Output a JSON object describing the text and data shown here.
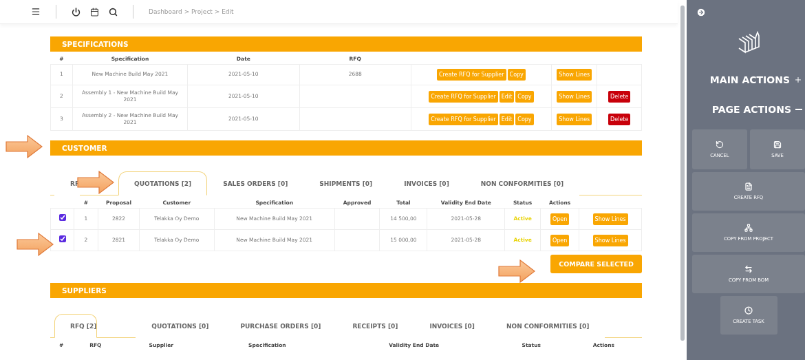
{
  "breadcrumb": "Dashboard > Project > Edit",
  "specifications": {
    "title": "SPECIFICATIONS",
    "columns": [
      "#",
      "Specification",
      "Date",
      "RFQ"
    ],
    "rows": [
      {
        "cells": [
          "1",
          "New Machine Build May 2021",
          "2021-05-10",
          "2688"
        ],
        "actions": [
          "Create RFQ for Supplier",
          "Copy"
        ],
        "show_lines": "Show Lines"
      },
      {
        "cells": [
          "2",
          "Assembly 1 - New Machine Build May 2021",
          "2021-05-10",
          ""
        ],
        "actions": [
          "Create RFQ for Supplier",
          "Edit",
          "Copy"
        ],
        "show_lines": "Show Lines",
        "delete": "Delete"
      },
      {
        "cells": [
          "3",
          "Assembly 2 - New Machine Build May 2021",
          "2021-05-10",
          ""
        ],
        "actions": [
          "Create RFQ for Supplier",
          "Edit",
          "Copy"
        ],
        "show_lines": "Show Lines",
        "delete": "Delete"
      }
    ]
  },
  "customer": {
    "title": "CUSTOMER",
    "tabs": [
      {
        "label": "RF",
        "selected": false
      },
      {
        "label": "QUOTATIONS [2]",
        "selected": true
      },
      {
        "label": "SALES ORDERS [0]",
        "selected": false
      },
      {
        "label": "SHIPMENTS [0]",
        "selected": false
      },
      {
        "label": "INVOICES [0]",
        "selected": false
      },
      {
        "label": "NON CONFORMITIES [0]",
        "selected": false
      }
    ],
    "columns": [
      "#",
      "Proposal",
      "Customer",
      "Specification",
      "Approved",
      "Total",
      "Validity End Date",
      "Status",
      "Actions"
    ],
    "rows": [
      {
        "checked": true,
        "cells": [
          "1",
          "2822",
          "Telakka Oy Demo",
          "New Machine Build May 2021",
          "",
          "14 500,00",
          "2021-05-28"
        ],
        "status": "Active",
        "actions": [
          "Open",
          "Show Lines"
        ]
      },
      {
        "checked": true,
        "cells": [
          "2",
          "2821",
          "Telakka Oy Demo",
          "New Machine Build May 2021",
          "",
          "15 000,00",
          "2021-05-28"
        ],
        "status": "Active",
        "actions": [
          "Open",
          "Show Lines"
        ]
      }
    ],
    "compare_button": "COMPARE SELECTED"
  },
  "suppliers": {
    "title": "SUPPLIERS",
    "tabs": [
      {
        "label": "RFQ [2]",
        "selected": true
      },
      {
        "label": "QUOTATIONS [0]",
        "selected": false
      },
      {
        "label": "PURCHASE ORDERS [0]",
        "selected": false
      },
      {
        "label": "RECEIPTS [0]",
        "selected": false
      },
      {
        "label": "INVOICES [0]",
        "selected": false
      },
      {
        "label": "NON CONFORMITIES [0]",
        "selected": false
      }
    ],
    "columns": [
      "#",
      "RFQ",
      "Supplier",
      "Specification",
      "Validity End Date",
      "Status",
      "Actions"
    ]
  },
  "sidebar": {
    "sections": [
      {
        "label": "MAIN ACTIONS",
        "expanded": false
      },
      {
        "label": "PAGE ACTIONS",
        "expanded": true
      }
    ],
    "actions": [
      {
        "label": "CANCEL",
        "kind": "half"
      },
      {
        "label": "SAVE",
        "kind": "half"
      },
      {
        "label": "CREATE RFQ",
        "kind": "wide"
      },
      {
        "label": "COPY FROM PROJECT",
        "kind": "wide"
      },
      {
        "label": "COPY FROM BOM",
        "kind": "wide"
      },
      {
        "label": "CREATE TASK",
        "kind": "narrow"
      }
    ]
  }
}
